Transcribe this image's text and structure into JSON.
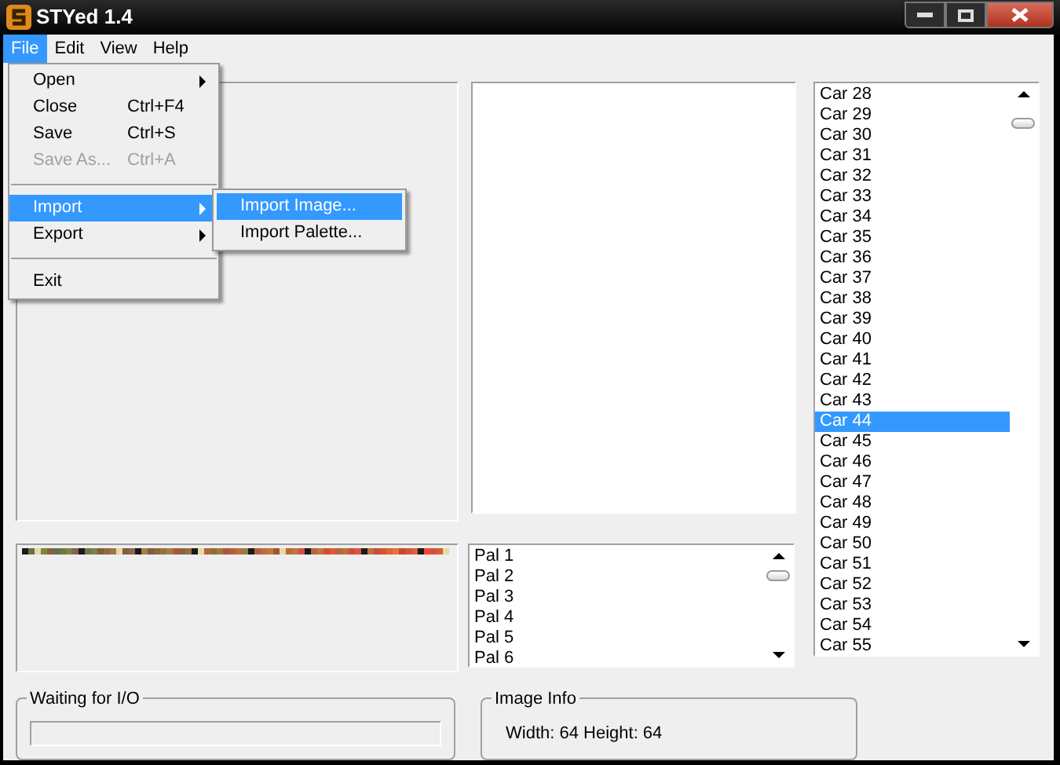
{
  "window": {
    "title": "STYed 1.4"
  },
  "menu_bar": [
    {
      "label": "File",
      "selected": true
    },
    {
      "label": "Edit",
      "selected": false
    },
    {
      "label": "View",
      "selected": false
    },
    {
      "label": "Help",
      "selected": false
    }
  ],
  "file_menu": [
    {
      "kind": "item",
      "label": "Open",
      "submenu": true,
      "selected": false,
      "disabled": false
    },
    {
      "kind": "item",
      "label": "Close",
      "shortcut": "Ctrl+F4",
      "submenu": false,
      "selected": false,
      "disabled": false
    },
    {
      "kind": "item",
      "label": "Save",
      "shortcut": "Ctrl+S",
      "submenu": false,
      "selected": false,
      "disabled": false
    },
    {
      "kind": "item",
      "label": "Save As...",
      "shortcut": "Ctrl+A",
      "submenu": false,
      "selected": false,
      "disabled": true
    },
    {
      "kind": "separator"
    },
    {
      "kind": "item",
      "label": "Import",
      "submenu": true,
      "selected": true,
      "disabled": false
    },
    {
      "kind": "item",
      "label": "Export",
      "submenu": true,
      "selected": false,
      "disabled": false
    },
    {
      "kind": "separator"
    },
    {
      "kind": "item",
      "label": "Exit",
      "submenu": false,
      "selected": false,
      "disabled": false
    }
  ],
  "import_submenu": [
    {
      "label": "Import Image...",
      "selected": true
    },
    {
      "label": "Import Palette...",
      "selected": false
    }
  ],
  "car_list": [
    {
      "label": "Car 28",
      "selected": false
    },
    {
      "label": "Car 29",
      "selected": false
    },
    {
      "label": "Car 30",
      "selected": false
    },
    {
      "label": "Car 31",
      "selected": false
    },
    {
      "label": "Car 32",
      "selected": false
    },
    {
      "label": "Car 33",
      "selected": false
    },
    {
      "label": "Car 34",
      "selected": false
    },
    {
      "label": "Car 35",
      "selected": false
    },
    {
      "label": "Car 36",
      "selected": false
    },
    {
      "label": "Car 37",
      "selected": false
    },
    {
      "label": "Car 38",
      "selected": false
    },
    {
      "label": "Car 39",
      "selected": false
    },
    {
      "label": "Car 40",
      "selected": false
    },
    {
      "label": "Car 41",
      "selected": false
    },
    {
      "label": "Car 42",
      "selected": false
    },
    {
      "label": "Car 43",
      "selected": false
    },
    {
      "label": "Car 44",
      "selected": true
    },
    {
      "label": "Car 45",
      "selected": false
    },
    {
      "label": "Car 46",
      "selected": false
    },
    {
      "label": "Car 47",
      "selected": false
    },
    {
      "label": "Car 48",
      "selected": false
    },
    {
      "label": "Car 49",
      "selected": false
    },
    {
      "label": "Car 50",
      "selected": false
    },
    {
      "label": "Car 51",
      "selected": false
    },
    {
      "label": "Car 52",
      "selected": false
    },
    {
      "label": "Car 53",
      "selected": false
    },
    {
      "label": "Car 54",
      "selected": false
    },
    {
      "label": "Car 55",
      "selected": false
    }
  ],
  "palette_list": [
    {
      "label": "Pal 1"
    },
    {
      "label": "Pal 2"
    },
    {
      "label": "Pal 3"
    },
    {
      "label": "Pal 4"
    },
    {
      "label": "Pal 5"
    },
    {
      "label": "Pal 6"
    }
  ],
  "status_group": {
    "title": "Waiting for I/O",
    "level": 0
  },
  "image_info": {
    "title": "Image Info",
    "text": "Width: 64 Height: 64"
  }
}
